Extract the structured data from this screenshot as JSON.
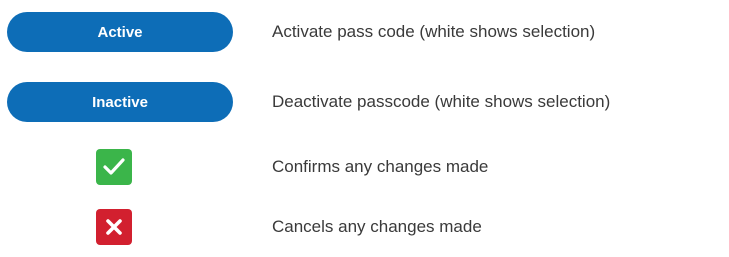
{
  "rows": [
    {
      "label": "Active",
      "description": "Activate pass code (white shows selection)"
    },
    {
      "label": "Inactive",
      "description": "Deactivate passcode (white shows selection)"
    },
    {
      "icon": "check-icon",
      "description": "Confirms any changes made"
    },
    {
      "icon": "close-icon",
      "description": "Cancels any changes made"
    }
  ],
  "colors": {
    "pill_blue": "#0d6db7",
    "confirm_green": "#3bb54a",
    "cancel_red": "#d2202f",
    "text": "#3a3a3a"
  }
}
